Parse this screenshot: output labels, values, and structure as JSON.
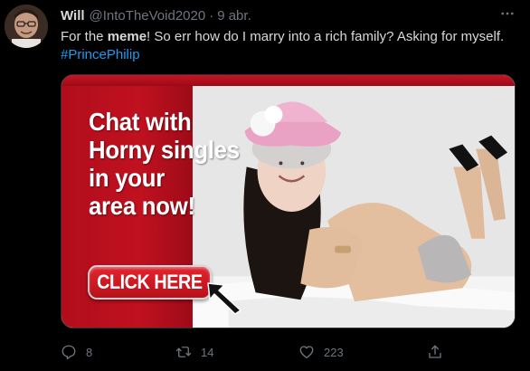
{
  "tweet": {
    "author_name": "Will",
    "author_handle": "@IntoTheVoid2020",
    "separator": "·",
    "timestamp": "9 abr.",
    "text_part1": "For the ",
    "text_bold": "meme",
    "text_part2": "! So err how do I marry into a rich family? Asking for myself.",
    "hashtag": "#PrincePhilip"
  },
  "media": {
    "ad_lines": [
      "Chat with",
      "Horny singles",
      "in your",
      "area now!"
    ],
    "button_label": "CLICK HERE"
  },
  "actions": {
    "replies": "8",
    "retweets": "14",
    "likes": "223"
  },
  "icons": {
    "avatar": "avatar",
    "more": "more-icon",
    "reply": "reply-icon",
    "retweet": "retweet-icon",
    "like": "heart-icon",
    "share": "share-icon",
    "cursor": "cursor-arrow-icon"
  },
  "colors": {
    "background": "#000000",
    "text": "#d9d9d9",
    "muted": "#6e767d",
    "link": "#1d9bf0",
    "ad_red": "#c0111f"
  }
}
